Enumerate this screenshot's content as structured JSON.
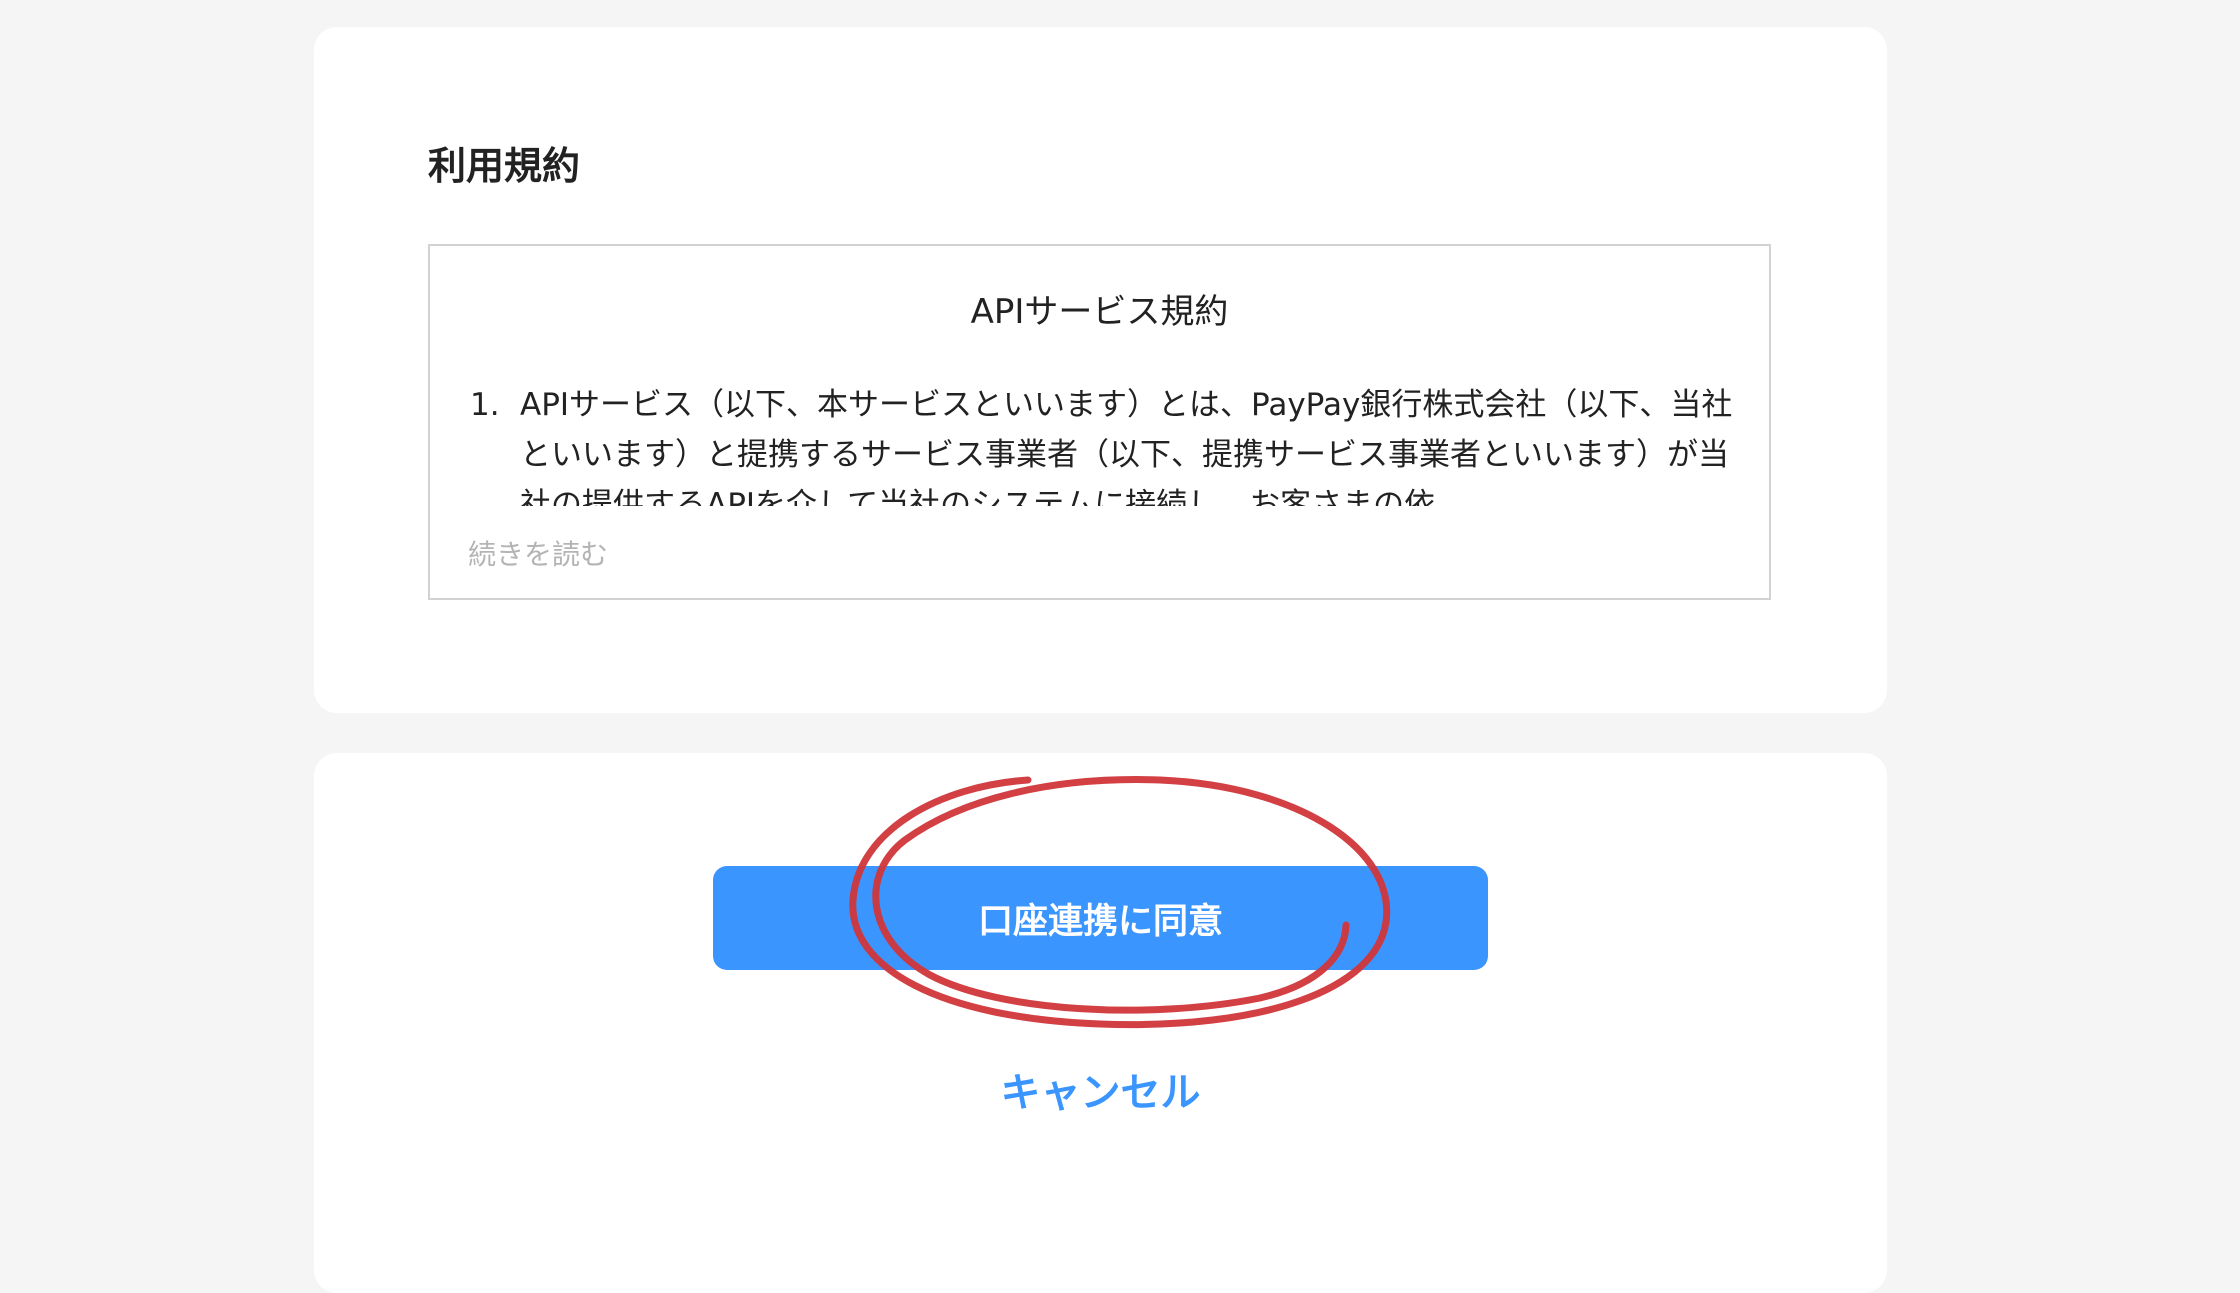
{
  "terms": {
    "section_title": "利用規約",
    "document_title": "APIサービス規約",
    "item_number": "1.",
    "item_text": "APIサービス（以下、本サービスといいます）とは、PayPay銀行株式会社（以下、当社といいます）と提携するサービス事業者（以下、提携サービス事業者といいます）が当社の提供するAPIを介して当社のシステムに接続し、お客さまの依",
    "read_more": "続きを読む"
  },
  "actions": {
    "agree_label": "口座連携に同意",
    "cancel_label": "キャンセル"
  },
  "colors": {
    "accent": "#3b95ff",
    "page_background": "#f5f5f5",
    "card_background": "#ffffff",
    "annotation": "#d0363a"
  }
}
